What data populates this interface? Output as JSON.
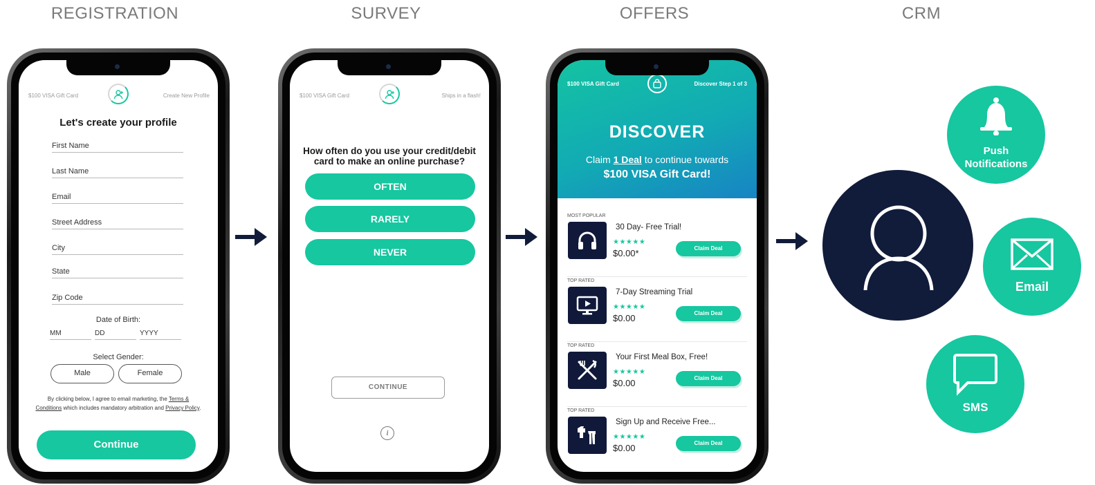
{
  "stages": {
    "registration": "REGISTRATION",
    "survey": "SURVEY",
    "offers": "OFFERS",
    "crm": "CRM"
  },
  "registration": {
    "header_left": "$100 VISA Gift Card",
    "header_right": "Create New Profile",
    "title": "Let's create your profile",
    "fields": {
      "first_name": "First Name",
      "last_name": "Last Name",
      "email": "Email",
      "street": "Street Address",
      "city": "City",
      "state": "State",
      "zip": "Zip Code"
    },
    "dob_label": "Date of Birth:",
    "dob": {
      "mm": "MM",
      "dd": "DD",
      "yyyy": "YYYY"
    },
    "gender_label": "Select Gender:",
    "gender": {
      "male": "Male",
      "female": "Female"
    },
    "legal": {
      "part1": "By clicking below, I agree to email marketing, the ",
      "terms": "Terms & Conditions",
      "part2": " which includes mandatory arbitration and ",
      "privacy": "Privacy Policy",
      "part3": "."
    },
    "continue_label": "Continue"
  },
  "survey": {
    "header_left": "$100 VISA Gift Card",
    "header_right": "Ships in a flash!",
    "question": "How often do you use your credit/debit card to make an online purchase?",
    "answers": [
      "OFTEN",
      "RARELY",
      "NEVER"
    ],
    "continue_label": "CONTINUE",
    "info_glyph": "i"
  },
  "offers": {
    "header_left": "$100 VISA Gift Card",
    "header_right": "Discover Step 1 of 3",
    "title": "DISCOVER",
    "claim_prefix": "Claim ",
    "claim_link": "1 Deal",
    "claim_suffix": " to continue towards",
    "gift": "$100 VISA Gift Card!",
    "deals": [
      {
        "tag": "MOST POPULAR",
        "name": "30 Day- Free Trial!",
        "stars": "★★★★★",
        "price": "$0.00*",
        "button": "Claim Deal",
        "icon": "headphones-icon"
      },
      {
        "tag": "TOP RATED",
        "name": "7-Day Streaming Trial",
        "stars": "★★★★★",
        "price": "$0.00",
        "button": "Claim Deal",
        "icon": "tv-play-icon"
      },
      {
        "tag": "TOP RATED",
        "name": "Your First Meal Box, Free!",
        "stars": "★★★★★",
        "price": "$0.00",
        "button": "Claim Deal",
        "icon": "fork-knife-icon"
      },
      {
        "tag": "TOP RATED",
        "name": "Sign Up and Receive Free...",
        "stars": "★★★★★",
        "price": "$0.00",
        "button": "Claim Deal",
        "icon": "clothing-icon"
      }
    ]
  },
  "crm": {
    "push_line1": "Push",
    "push_line2": "Notifications",
    "email": "Email",
    "sms": "SMS"
  },
  "colors": {
    "accent": "#16c7a0",
    "navy": "#111c3a",
    "stage_title": "#7a7a7a"
  }
}
